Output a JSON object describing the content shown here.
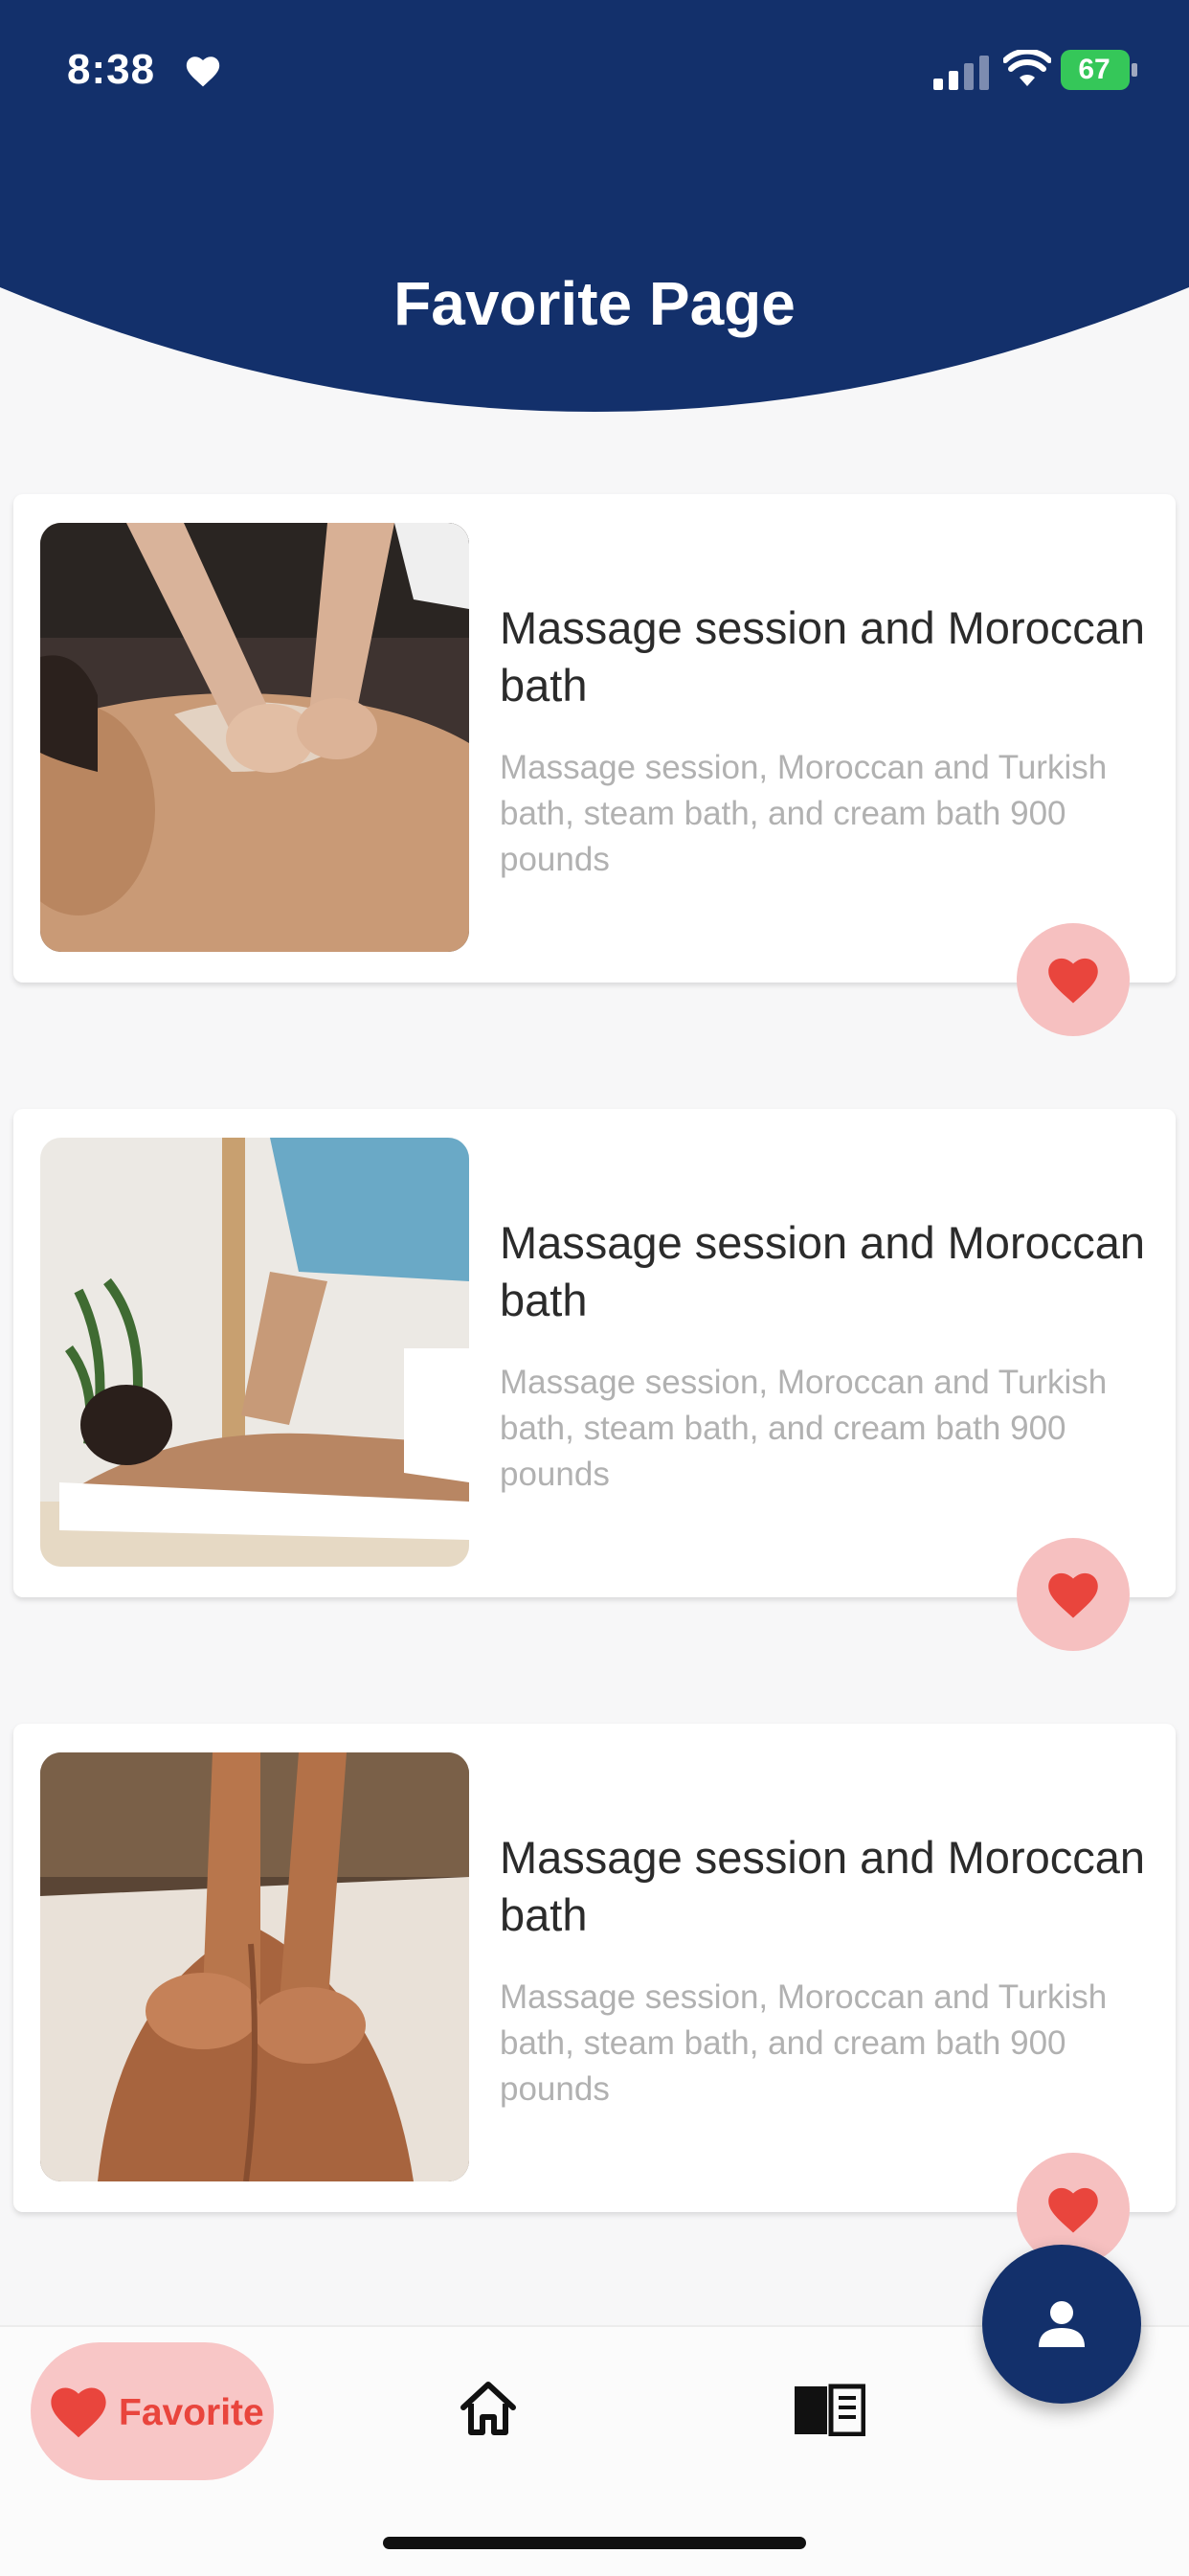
{
  "status_bar": {
    "time": "8:38",
    "battery": "67"
  },
  "header": {
    "title": "Favorite Page"
  },
  "favorites": [
    {
      "title": "Massage session and Moroccan bath",
      "description": "Massage session, Moroccan and Turkish bath, steam bath, and cream bath 900 pounds",
      "image": "salt-scrub-back-massage-photo",
      "favorited": true
    },
    {
      "title": "Massage session and Moroccan bath",
      "description": "Massage session, Moroccan and Turkish bath, steam bath, and cream bath 900 pounds",
      "image": "therapist-back-massage-photo",
      "favorited": true
    },
    {
      "title": "Massage session and Moroccan bath",
      "description": "Massage session, Moroccan and Turkish bath, steam bath, and cream bath 900 pounds",
      "image": "oil-back-massage-photo",
      "favorited": true
    }
  ],
  "bottom_nav": {
    "items": [
      {
        "label": "Favorite",
        "icon": "heart-icon",
        "active": true
      },
      {
        "label": "",
        "icon": "home-icon",
        "active": false
      },
      {
        "label": "",
        "icon": "book-icon",
        "active": false
      }
    ]
  },
  "fab": {
    "icon": "person-icon"
  },
  "colors": {
    "primary": "#13306b",
    "accent": "#e9453d",
    "accent_light": "#f8c6c6",
    "background": "#f7f7f8"
  }
}
